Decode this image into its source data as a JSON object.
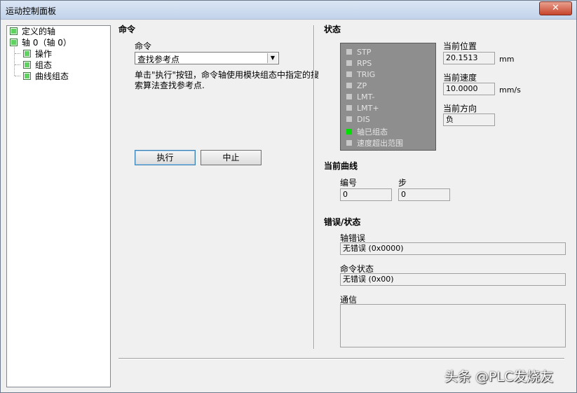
{
  "window": {
    "title": "运动控制面板",
    "close_label": "✕"
  },
  "tree": {
    "root": "定义的轴",
    "axis": "轴 0（轴 0）",
    "children": [
      "操作",
      "组态",
      "曲线组态"
    ]
  },
  "command": {
    "heading": "命令",
    "label": "命令",
    "selected": "查找参考点",
    "description": "单击\"执行\"按钮，命令轴使用模块组态中指定的搜索算法查找参考点.",
    "execute_label": "执行",
    "abort_label": "中止"
  },
  "status": {
    "heading": "状态",
    "flags": [
      {
        "label": "STP",
        "on": false
      },
      {
        "label": "RPS",
        "on": false
      },
      {
        "label": "TRIG",
        "on": false
      },
      {
        "label": "ZP",
        "on": false
      },
      {
        "label": "LMT-",
        "on": false
      },
      {
        "label": "LMT+",
        "on": false
      },
      {
        "label": "DIS",
        "on": false
      },
      {
        "label": "轴已组态",
        "on": true
      },
      {
        "label": "速度超出范围",
        "on": false
      }
    ],
    "position_label": "当前位置",
    "position_value": "20.1513",
    "position_unit": "mm",
    "speed_label": "当前速度",
    "speed_value": "10.0000",
    "speed_unit": "mm/s",
    "direction_label": "当前方向",
    "direction_value": "负"
  },
  "profile": {
    "heading": "当前曲线",
    "number_label": "编号",
    "number_value": "0",
    "step_label": "步",
    "step_value": "0"
  },
  "error": {
    "heading": "错误/状态",
    "axis_error_label": "轴错误",
    "axis_error_value": "无错误 (0x0000)",
    "command_status_label": "命令状态",
    "command_status_value": "无错误 (0x00)",
    "comm_label": "通信",
    "comm_value": ""
  },
  "watermark": "头条 @PLC发烧友",
  "colors": {
    "led_on": "#00e000",
    "led_off": "#c8c8c8",
    "status_panel": "#8e8e8e"
  }
}
